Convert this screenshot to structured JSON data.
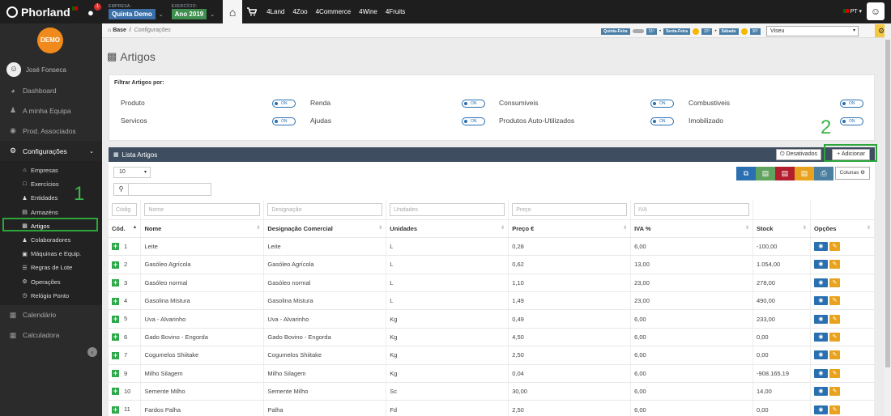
{
  "topbar": {
    "logo": "Phorland",
    "notifications": "1",
    "empresa_label": "EMPRESA:",
    "empresa_value": "Quinta Demo",
    "exercicio_label": "EXERCÍCIO:",
    "exercicio_value": "Ano 2019",
    "apps": [
      "4Land",
      "4Zoo",
      "4Commerce",
      "4Wine",
      "4Fruits"
    ],
    "language": "PT"
  },
  "sidebar": {
    "demo_badge": "DEMO",
    "user_name": "José Fonseca",
    "menu": [
      {
        "label": "Dashboard",
        "icon": "dashboard-icon"
      },
      {
        "label": "A minha Equipa",
        "icon": "team-icon"
      },
      {
        "label": "Prod. Associados",
        "icon": "products-icon"
      },
      {
        "label": "Configurações",
        "icon": "gears-icon"
      }
    ],
    "submenu": [
      "Empresas",
      "Exercícios",
      "Entidades",
      "Armazéns",
      "Artigos",
      "Colaboradores",
      "Máquinas e Equip.",
      "Regras de Lote",
      "Operações",
      "Relógio Ponto"
    ],
    "bottom": [
      "Calendário",
      "Calculadora"
    ]
  },
  "breadcrumb": {
    "root": "Base",
    "current": "Configurações"
  },
  "weather": [
    {
      "day": "Quinta-Feira",
      "temp": "31º"
    },
    {
      "day": "Sexta-Feira",
      "temp": "32º"
    },
    {
      "day": "Sábado",
      "temp": "30º"
    }
  ],
  "city": "Viseu",
  "page_title": "Artigos",
  "filter": {
    "title": "Filtrar Artigos por:",
    "toggle_label": "ON",
    "items": [
      "Produto",
      "Renda",
      "Consumiveis",
      "Combustiveis",
      "Servicos",
      "Ajudas",
      "Produtos Auto-Utilizados",
      "Imobilizado"
    ]
  },
  "annotations": {
    "one": "1",
    "two": "2"
  },
  "list": {
    "title": "Lista Artigos",
    "desativados": "Desativados",
    "adicionar": "Adicionar",
    "page_size": "10",
    "colunas": "Colunas",
    "filters": [
      "Códig",
      "Nome",
      "Designação",
      "Unidades",
      "Preço",
      "IVA"
    ],
    "headers": [
      "Cód.",
      "Nome",
      "Designação Comercial",
      "Unidades",
      "Preço €",
      "IVA %",
      "Stock",
      "Opções"
    ],
    "rows": [
      [
        "1",
        "Leite",
        "Leite",
        "L",
        "0,28",
        "6,00",
        "-100,00"
      ],
      [
        "2",
        "Gasóleo Agrícola",
        "Gasóleo Agrícola",
        "L",
        "0,62",
        "13,00",
        "1.054,00"
      ],
      [
        "3",
        "Gasóleo normal",
        "Gasóleo normal",
        "L",
        "1,10",
        "23,00",
        "278,00"
      ],
      [
        "4",
        "Gasolina Mistura",
        "Gasolina Mistura",
        "L",
        "1,49",
        "23,00",
        "490,00"
      ],
      [
        "5",
        "Uva - Alvarinho",
        "Uva - Alvarinho",
        "Kg",
        "0,49",
        "6,00",
        "233,00"
      ],
      [
        "6",
        "Gado Bovino - Engorda",
        "Gado Bovino - Engorda",
        "Kg",
        "4,50",
        "6,00",
        "0,00"
      ],
      [
        "7",
        "Cogumelos Shiitake",
        "Cogumelos Shiitake",
        "Kg",
        "2,50",
        "6,00",
        "0,00"
      ],
      [
        "9",
        "Milho Silagem",
        "Milho Silagem",
        "Kg",
        "0,04",
        "6,00",
        "-908.165,19"
      ],
      [
        "10",
        "Semente Milho",
        "Semente Milho",
        "Sc",
        "30,00",
        "6,00",
        "14,00"
      ],
      [
        "11",
        "Fardos Palha",
        "Palha",
        "Fd",
        "2,50",
        "6,00",
        "0,00"
      ]
    ]
  }
}
